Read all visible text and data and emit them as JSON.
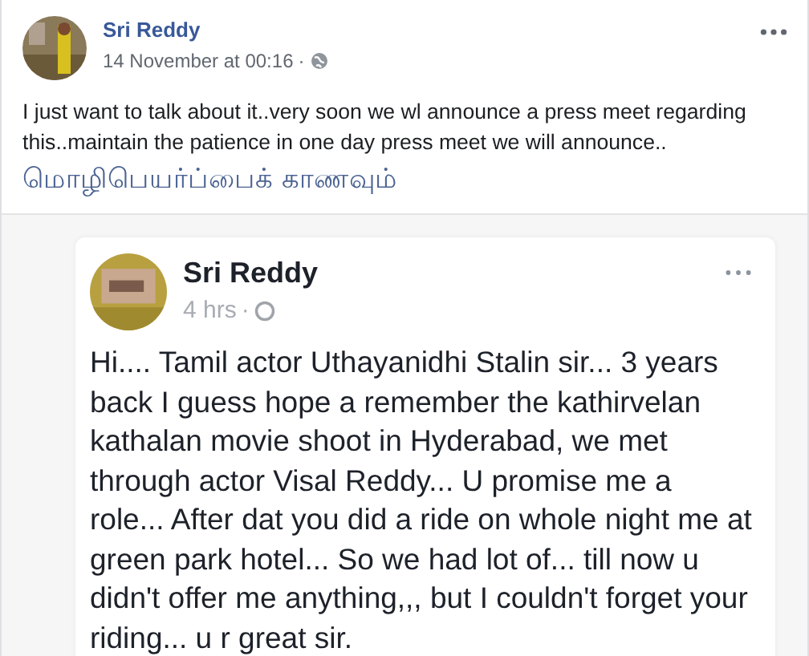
{
  "post": {
    "author": "Sri Reddy",
    "timestamp": "14 November at 00:16",
    "separator": "·",
    "text": "I just want to talk about it..very soon we wl announce a press meet regarding this..maintain the patience in one day press meet we will announce..",
    "translation_link": "மொழிபெயர்ப்பைக் காணவும்"
  },
  "shared_screenshot": {
    "author": "Sri Reddy",
    "timestamp": "4 hrs",
    "separator": "·",
    "text": "Hi.... Tamil actor Uthayanidhi Stalin sir... 3 years back I guess hope a remember the kathirvelan kathalan movie shoot in Hyderabad, we met through actor Visal Reddy... U promise me a role... After dat you did a ride on whole night me at green park hotel... So we had lot of... till now u didn't offer me anything,,, but I couldn't forget your riding... u r great sir."
  }
}
